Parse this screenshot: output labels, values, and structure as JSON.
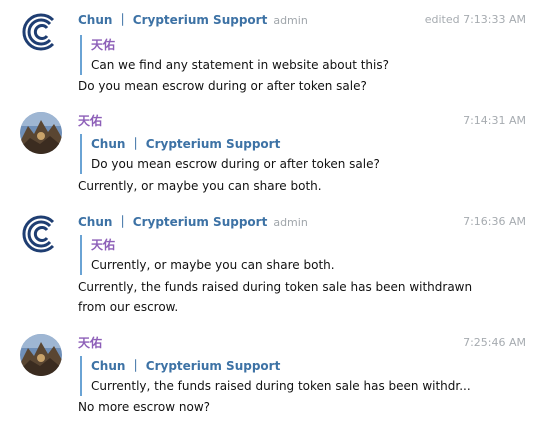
{
  "colors": {
    "admin_name": "#3d72a5",
    "user_name": "#8d5fb8",
    "reply_bar": "#6aa3d4",
    "timestamp": "#a6abb0"
  },
  "messages": [
    {
      "avatar": "crypterium-logo",
      "sender": "Chun ｜ Crypterium Support",
      "role": "admin",
      "time": "edited 7:13:33 AM",
      "reply_to": {
        "name": "天佑",
        "text": "Can we find any statement in website about this?"
      },
      "text": "Do you mean escrow during or after token sale?"
    },
    {
      "avatar": "user-photo",
      "sender": "天佑",
      "role": "",
      "time": "7:14:31 AM",
      "reply_to": {
        "name": "Chun ｜ Crypterium Support",
        "text": "Do you mean escrow during or after token sale?"
      },
      "text": "Currently, or maybe you can share both."
    },
    {
      "avatar": "crypterium-logo",
      "sender": "Chun ｜ Crypterium Support",
      "role": "admin",
      "time": "7:16:36 AM",
      "reply_to": {
        "name": "天佑",
        "text": "Currently, or maybe you can share both."
      },
      "text": "Currently, the funds raised during token sale has been withdrawn from our escrow."
    },
    {
      "avatar": "user-photo",
      "sender": "天佑",
      "role": "",
      "time": "7:25:46 AM",
      "reply_to": {
        "name": "Chun ｜ Crypterium Support",
        "text": "Currently, the funds raised during token sale has been withdr..."
      },
      "text": "No more escrow now?"
    }
  ]
}
